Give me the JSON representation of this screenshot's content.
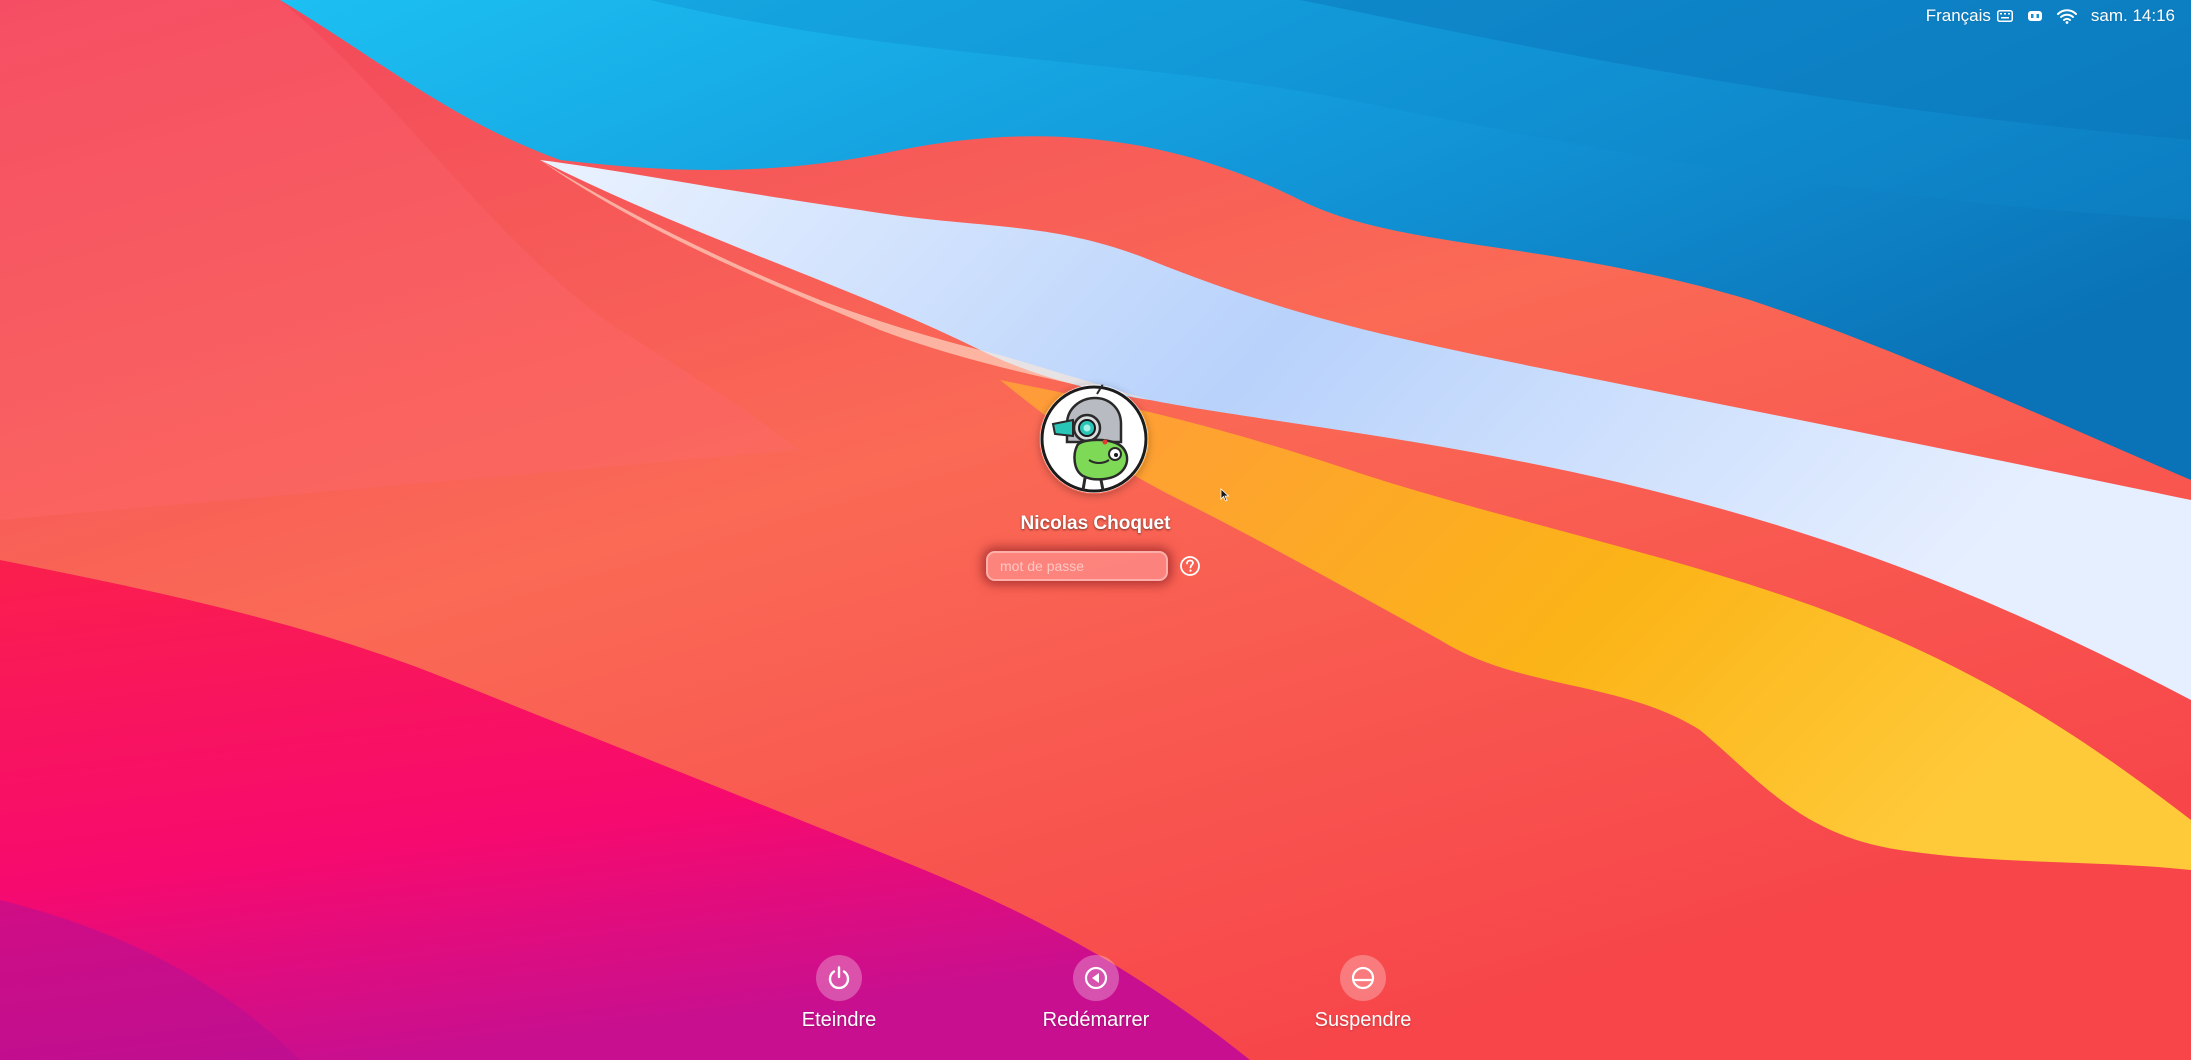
{
  "menubar": {
    "language": "Français",
    "keyboard_icon": "keyboard-icon",
    "accessibility_icon": "accessibility-icon",
    "wifi_icon": "wifi-icon",
    "clock": "sam. 14:16"
  },
  "login": {
    "user_name": "Nicolas Choquet",
    "password_placeholder": "mot de passe",
    "hint_icon": "question-mark-icon"
  },
  "actions": {
    "shutdown_label": "Eteindre",
    "restart_label": "Redémarrer",
    "sleep_label": "Suspendre"
  },
  "colors": {
    "sky_blue": "#1aa3e6",
    "pale_band": "#cfe0f7",
    "orange_band": "#fbb13a",
    "red_wave": "#f43a52",
    "magenta": "#f0116c"
  }
}
